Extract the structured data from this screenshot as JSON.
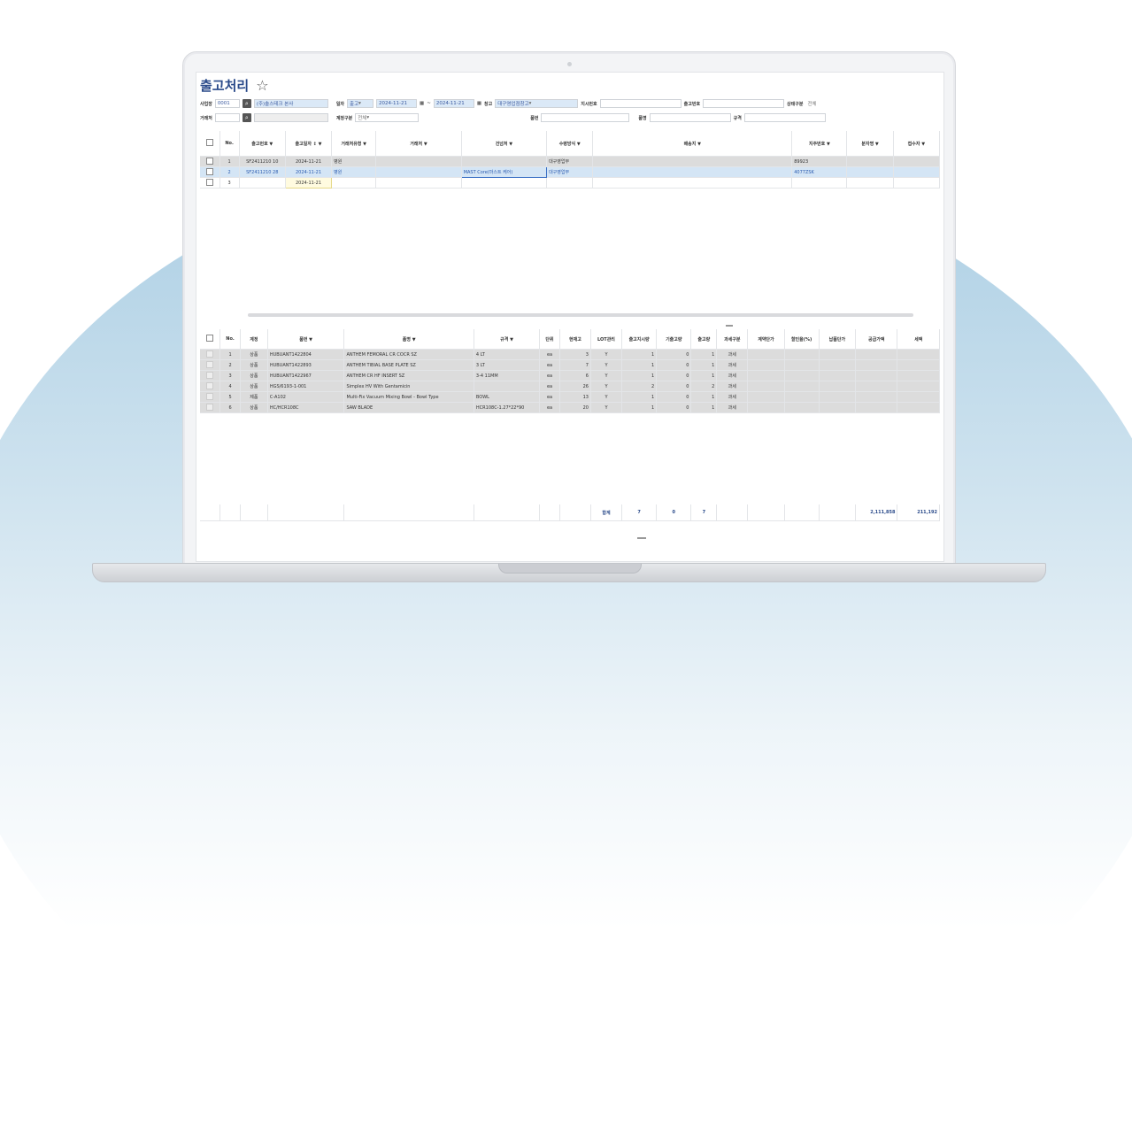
{
  "page": {
    "title": "출고처리",
    "star_icon": "star-outline-icon"
  },
  "filters": {
    "row1": {
      "site_label": "사업장",
      "site_code": "0001",
      "site_name": "(주)솔스테크 본사",
      "date_label": "일자",
      "date_type": "출고",
      "date_from": "2024-11-21",
      "date_sep": "~",
      "date_to": "2024-11-21",
      "warehouse_label": "창고",
      "warehouse_value": "대구영업점창고",
      "order_no_label": "지시번호",
      "out_no_label": "출고번호",
      "status_label": "상태구분",
      "status_value": "전체"
    },
    "row2": {
      "customer_label": "거래처",
      "account_type_label": "계정구분",
      "account_type_value": "전체",
      "item_label": "품번",
      "item_name_label": "품명",
      "spec_label": "규격"
    }
  },
  "grid1": {
    "headers": [
      "No.",
      "출고번호 ▼",
      "출고일자 ↕ ▼",
      "거래처유형 ▼",
      "거래처 ▼",
      "건넘처 ▼",
      "수령방식 ▼",
      "배송지 ▼",
      "지주번호 ▼",
      "분자명 ▼",
      "접수자 ▼"
    ],
    "rows": [
      {
        "no": "1",
        "out_no": "SF2411210 10",
        "date": "2024-11-21",
        "type": "병원",
        "customer": "",
        "consignee": "",
        "method": "대구영업부",
        "address": "",
        "ref": "89923",
        "style": "gray"
      },
      {
        "no": "2",
        "out_no": "SF2411210 28",
        "date": "2024-11-21",
        "type": "병원",
        "customer": "",
        "consignee": "MAST Core(마스트 케어)",
        "method": "대구영업부",
        "address": "",
        "ref": "4077ZSK",
        "style": "sel"
      },
      {
        "no": "3",
        "out_no": "",
        "date": "2024-11-21",
        "type": "",
        "customer": "",
        "consignee": "",
        "method": "",
        "address": "",
        "ref": "",
        "style": "plain"
      }
    ]
  },
  "grid2": {
    "headers": [
      "No.",
      "계정",
      "품번 ▼",
      "품명 ▼",
      "규격 ▼",
      "단위",
      "현재고",
      "LOT관리",
      "출고지시량",
      "기출고량",
      "출고량",
      "과세구분",
      "계약단가",
      "할인율(%)",
      "납품단가",
      "공급가액",
      "세액"
    ],
    "rows": [
      {
        "no": "1",
        "acct": "상품",
        "item": "HUBUANT1422804",
        "name": "ANTHEM FEMORAL CR COCR SZ",
        "spec": "4 LT",
        "unit": "ea",
        "stock": "3",
        "lot": "Y",
        "order": "1",
        "prev": "0",
        "qty": "1",
        "tax": "과세"
      },
      {
        "no": "2",
        "acct": "상품",
        "item": "HUBUANT1422893",
        "name": "ANTHEM TIBIAL BASE PLATE SZ",
        "spec": "3 LT",
        "unit": "ea",
        "stock": "7",
        "lot": "Y",
        "order": "1",
        "prev": "0",
        "qty": "1",
        "tax": "과세"
      },
      {
        "no": "3",
        "acct": "상품",
        "item": "HUBUANT1422967",
        "name": "ANTHEM CR HF INSERT SZ",
        "spec": "3-4 11MM",
        "unit": "ea",
        "stock": "6",
        "lot": "Y",
        "order": "1",
        "prev": "0",
        "qty": "1",
        "tax": "과세"
      },
      {
        "no": "4",
        "acct": "상품",
        "item": "HGS/6193-1-001",
        "name": "Simplex HV With Gentamicin",
        "spec": "",
        "unit": "ea",
        "stock": "26",
        "lot": "Y",
        "order": "2",
        "prev": "0",
        "qty": "2",
        "tax": "과세"
      },
      {
        "no": "5",
        "acct": "제품",
        "item": "C-A102",
        "name": "Multi-Fix Vacuum Mixing Bowl - Bowl Type",
        "spec": "BOWL",
        "unit": "ea",
        "stock": "13",
        "lot": "Y",
        "order": "1",
        "prev": "0",
        "qty": "1",
        "tax": "과세"
      },
      {
        "no": "6",
        "acct": "상품",
        "item": "HC/HCR108C",
        "name": "SAW BLADE",
        "spec": "HCR108C-1.27*22*90",
        "unit": "ea",
        "stock": "20",
        "lot": "Y",
        "order": "1",
        "prev": "0",
        "qty": "1",
        "tax": "과세"
      }
    ],
    "summary": {
      "label": "합계",
      "order_total": "7",
      "prev_total": "0",
      "qty_total": "7",
      "supply_total": "2,111,858",
      "tax_total": "211,192"
    }
  },
  "colors": {
    "title": "#2a4a8a",
    "selected_row": "#d4e5f5",
    "gray_row": "#dcdcdc"
  }
}
